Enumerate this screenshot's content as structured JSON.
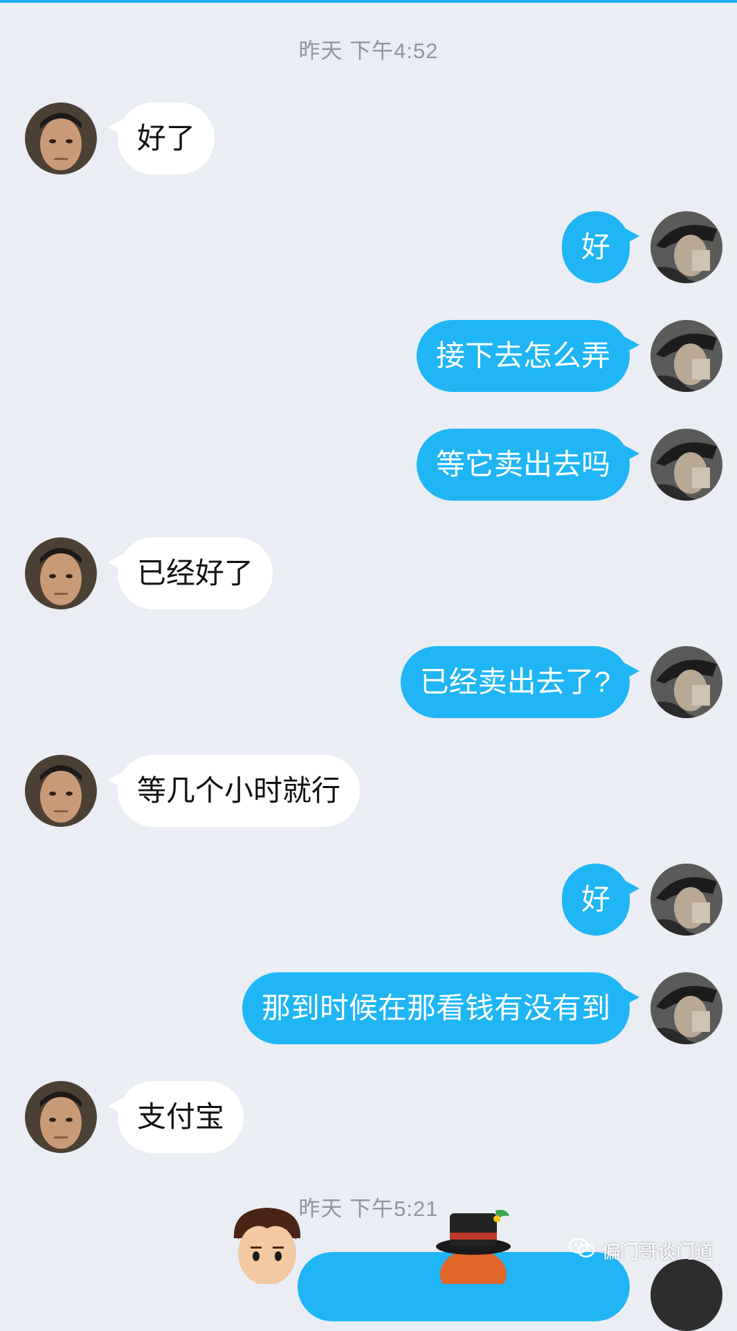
{
  "timestamps": [
    "昨天 下午4:52",
    "昨天 下午5:21"
  ],
  "messages": [
    {
      "side": "left",
      "text": "好了"
    },
    {
      "side": "right",
      "text": "好"
    },
    {
      "side": "right",
      "text": "接下去怎么弄"
    },
    {
      "side": "right",
      "text": "等它卖出去吗"
    },
    {
      "side": "left",
      "text": "已经好了"
    },
    {
      "side": "right",
      "text": "已经卖出去了?"
    },
    {
      "side": "left",
      "text": "等几个小时就行"
    },
    {
      "side": "right",
      "text": "好"
    },
    {
      "side": "right",
      "text": "那到时候在那看钱有没有到"
    },
    {
      "side": "left",
      "text": "支付宝"
    }
  ],
  "watermark": {
    "text": "偏门哥谈门道",
    "icon": "wechat-icon"
  },
  "colors": {
    "background": "#eaedf4",
    "sent_bubble": "#20b6f5",
    "received_bubble": "#ffffff",
    "timestamp": "#8f959e",
    "accent": "#1ab0ee"
  }
}
